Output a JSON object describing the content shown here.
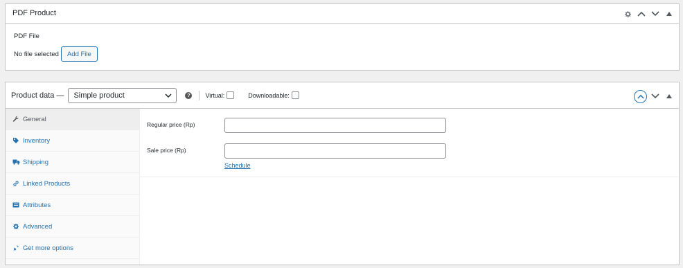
{
  "pdf_product": {
    "title": "PDF Product",
    "file_label": "PDF File",
    "file_status": "No file selected",
    "add_file_label": "Add File"
  },
  "product_data": {
    "title": "Product data —",
    "product_type": "Simple product",
    "help_icon": "?",
    "virtual_label": "Virtual:",
    "downloadable_label": "Downloadable:",
    "tabs": [
      {
        "label": "General",
        "icon": "wrench-icon",
        "active": true
      },
      {
        "label": "Inventory",
        "icon": "tag-icon",
        "active": false
      },
      {
        "label": "Shipping",
        "icon": "truck-icon",
        "active": false
      },
      {
        "label": "Linked Products",
        "icon": "link-icon",
        "active": false
      },
      {
        "label": "Attributes",
        "icon": "list-icon",
        "active": false
      },
      {
        "label": "Advanced",
        "icon": "gear-icon",
        "active": false
      },
      {
        "label": "Get more options",
        "icon": "plugin-icon",
        "active": false
      }
    ],
    "general": {
      "regular_price_label": "Regular price (Rp)",
      "regular_price_value": "",
      "sale_price_label": "Sale price (Rp)",
      "sale_price_value": "",
      "schedule_link": "Schedule"
    }
  },
  "colors": {
    "accent": "#2271b1",
    "border": "#c3c4c7",
    "background": "#f0f0f1"
  }
}
